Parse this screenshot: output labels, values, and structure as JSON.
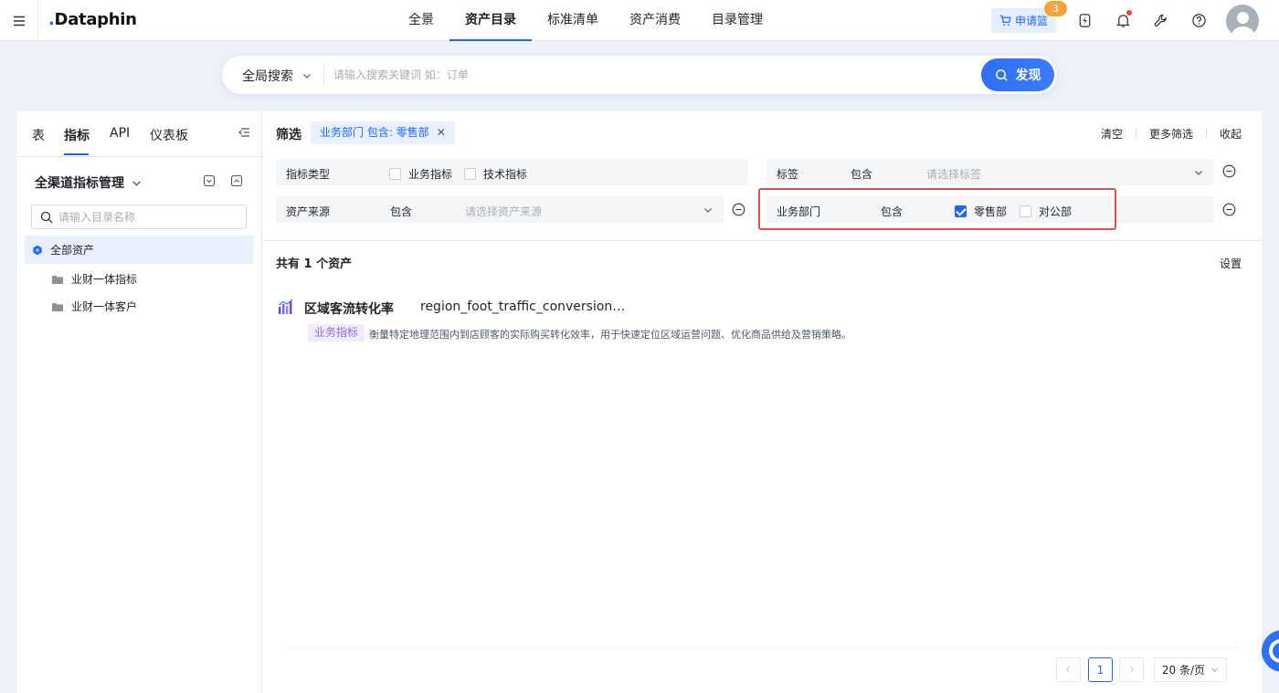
{
  "app": {
    "logo": "Dataphin"
  },
  "nav": {
    "items": [
      "全景",
      "资产目录",
      "标准清单",
      "资产消费",
      "目录管理"
    ],
    "active_index": 1
  },
  "header": {
    "cart_label": "申请篮",
    "cart_count": "3"
  },
  "search": {
    "scope": "全局搜索",
    "placeholder": "请输入搜索关键词 如：订单",
    "button": "发现"
  },
  "left": {
    "tabs": [
      "表",
      "指标",
      "API",
      "仪表板"
    ],
    "active_tab": 1,
    "tree_title": "全渠道指标管理",
    "search_placeholder": "请输入目录名称",
    "tree_all": "全部资产",
    "tree_items": [
      "业财一体指标",
      "业财一体客户"
    ]
  },
  "filter": {
    "title": "筛选",
    "chip": "业务部门 包含: 零售部",
    "actions": {
      "clear": "清空",
      "more": "更多筛选",
      "collapse": "收起"
    },
    "metric_type": {
      "label": "指标类型",
      "options": [
        {
          "label": "业务指标",
          "checked": false
        },
        {
          "label": "技术指标",
          "checked": false
        }
      ]
    },
    "tag": {
      "label": "标签",
      "op": "包含",
      "placeholder": "请选择标签"
    },
    "source": {
      "label": "资产来源",
      "op": "包含",
      "placeholder": "请选择资产来源"
    },
    "dept": {
      "label": "业务部门",
      "op": "包含",
      "options": [
        {
          "label": "零售部",
          "checked": true
        },
        {
          "label": "对公部",
          "checked": false
        }
      ]
    }
  },
  "results": {
    "count_text": "共有 1 个资产",
    "settings": "设置",
    "items": [
      {
        "name": "区域客流转化率",
        "code": "region_foot_traffic_conversion…",
        "tag": "业务指标",
        "description": "衡量特定地理范围内到店顾客的实际购买转化效率，用于快速定位区域运营问题、优化商品供给及营销策略。"
      }
    ]
  },
  "pagination": {
    "current": "1",
    "page_size": "20 条/页"
  },
  "colors": {
    "primary": "#1a66ff",
    "highlight_border": "#d9534f",
    "tag_purple": "#8f6bd9"
  },
  "icons": [
    "menu-icon",
    "cart-icon",
    "lightning-icon",
    "bell-icon",
    "tool-icon",
    "help-icon",
    "search-icon",
    "chevron-down-icon",
    "collapse-icon",
    "expand-all-icon",
    "collapse-all-icon",
    "folder-icon",
    "asset-root-icon",
    "minus-circle-icon",
    "close-icon",
    "metric-chart-icon"
  ]
}
